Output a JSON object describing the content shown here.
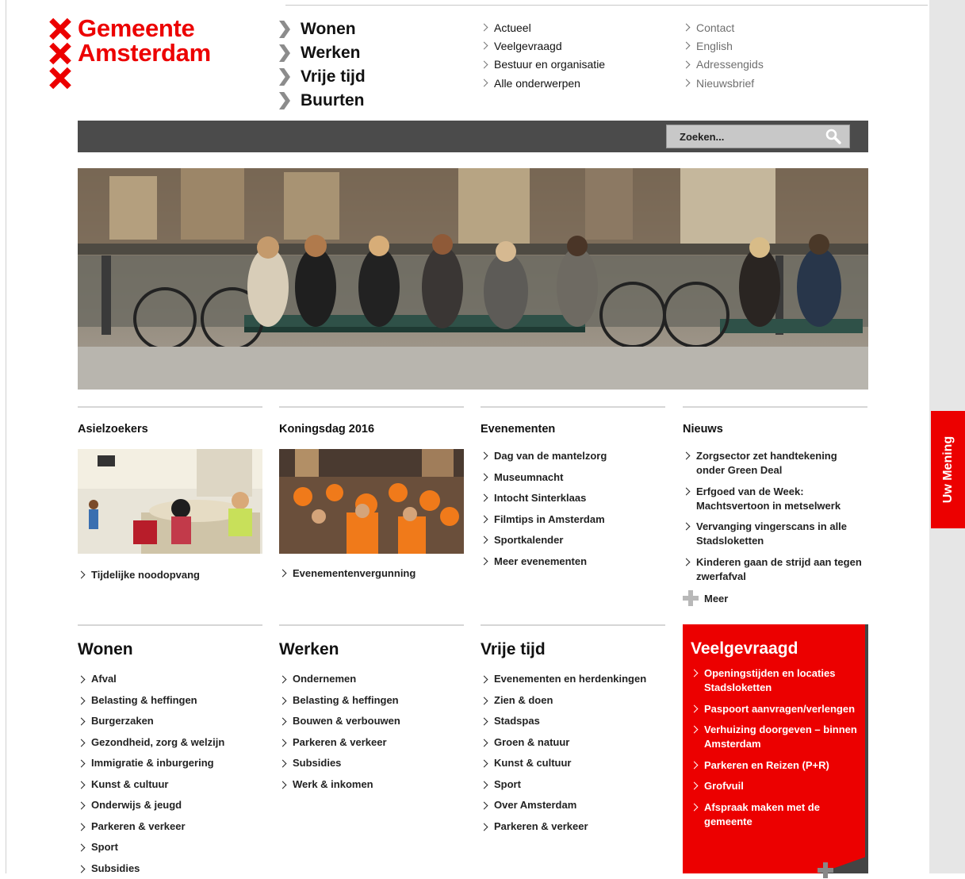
{
  "logo": {
    "lines": [
      "Gemeente",
      "Amsterdam",
      ""
    ]
  },
  "main_nav": [
    "Wonen",
    "Werken",
    "Vrije tijd",
    "Buurten"
  ],
  "top_links_1": [
    "Actueel",
    "Veelgevraagd",
    "Bestuur en organisatie",
    "Alle onderwerpen"
  ],
  "top_links_2": [
    "Contact",
    "English",
    "Adressengids",
    "Nieuwsbrief"
  ],
  "search": {
    "placeholder": "Zoeken..."
  },
  "colors": {
    "brand_red": "#ec0000",
    "dark_bar": "#4b4b4b"
  },
  "icons": {
    "search": "search-icon",
    "chevron": "chevron-right-icon",
    "plus": "plus-icon",
    "logo_cross": "x-cross-icon"
  },
  "features": {
    "asiel": {
      "title": "Asielzoekers",
      "link": "Tijdelijke noodopvang"
    },
    "koningsdag": {
      "title": "Koningsdag 2016",
      "link": "Evenementenvergunning"
    },
    "evenementen": {
      "title": "Evenementen",
      "links": [
        "Dag van de mantelzorg",
        "Museumnacht",
        "Intocht Sinterklaas",
        "Filmtips in Amsterdam",
        "Sportkalender",
        "Meer evenementen"
      ]
    },
    "nieuws": {
      "title": "Nieuws",
      "links": [
        "Zorgsector zet handtekening onder Green Deal",
        "Erfgoed van de Week: Machtsvertoon in metselwerk",
        "Vervanging vingerscans in alle Stadsloketten",
        "Kinderen gaan de strijd aan tegen zwerfafval"
      ],
      "more": "Meer"
    }
  },
  "sections": {
    "wonen": {
      "title": "Wonen",
      "links": [
        "Afval",
        "Belasting & heffingen",
        "Burgerzaken",
        "Gezondheid, zorg & welzijn",
        "Immigratie & inburgering",
        "Kunst & cultuur",
        "Onderwijs & jeugd",
        "Parkeren & verkeer",
        "Sport",
        "Subsidies"
      ]
    },
    "werken": {
      "title": "Werken",
      "links": [
        "Ondernemen",
        "Belasting & heffingen",
        "Bouwen & verbouwen",
        "Parkeren & verkeer",
        "Subsidies",
        "Werk & inkomen"
      ]
    },
    "vrijetijd": {
      "title": "Vrije tijd",
      "links": [
        "Evenementen en herdenkingen",
        "Zien & doen",
        "Stadspas",
        "Groen & natuur",
        "Kunst & cultuur",
        "Sport",
        "Over Amsterdam",
        "Parkeren & verkeer"
      ]
    }
  },
  "faq": {
    "title": "Veelgevraagd",
    "links": [
      "Openingstijden en locaties Stadsloketten",
      "Paspoort aanvragen/verlengen",
      "Verhuizing doorgeven – binnen Amsterdam",
      "Parkeren en Reizen (P+R)",
      "Grofvuil",
      "Afspraak maken met de gemeente"
    ]
  },
  "feedback": {
    "label": "Uw Mening"
  }
}
